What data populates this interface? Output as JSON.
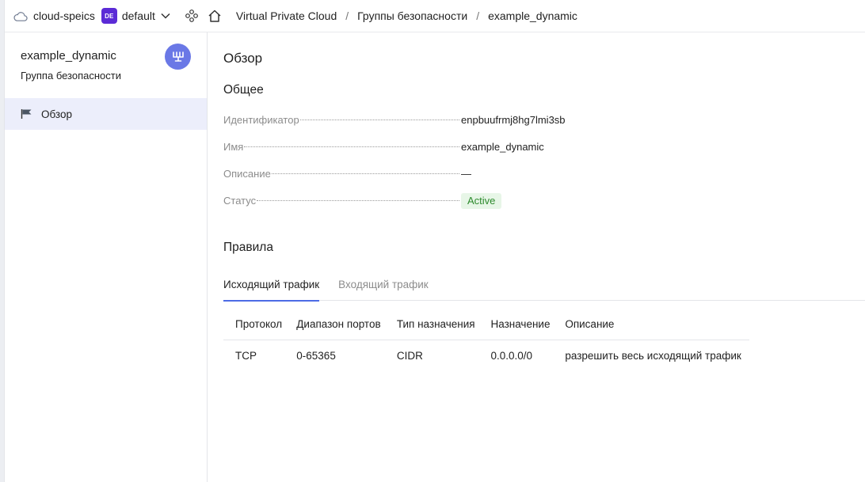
{
  "topbar": {
    "cloud_name": "cloud-speics",
    "folder_badge": "DE",
    "folder_name": "default",
    "breadcrumbs": [
      "Virtual Private Cloud",
      "Группы безопасности",
      "example_dynamic"
    ],
    "separator": "/"
  },
  "sidebar": {
    "resource_title": "example_dynamic",
    "resource_subtitle": "Группа безопасности",
    "items": [
      {
        "label": "Обзор",
        "icon": "flag-icon",
        "active": true
      }
    ]
  },
  "main": {
    "page_title": "Обзор",
    "general_title": "Общее",
    "properties": [
      {
        "key": "Идентификатор",
        "value": "enpbuufrmj8hg7lmi3sb"
      },
      {
        "key": "Имя",
        "value": "example_dynamic"
      },
      {
        "key": "Описание",
        "value": "—"
      },
      {
        "key": "Статус",
        "value": "Active"
      }
    ],
    "rules_title": "Правила",
    "tabs": [
      {
        "label": "Исходящий трафик",
        "active": true
      },
      {
        "label": "Входящий трафик",
        "active": false
      }
    ],
    "table": {
      "columns": [
        "Протокол",
        "Диапазон портов",
        "Тип назначения",
        "Назначение",
        "Описание"
      ],
      "rows": [
        [
          "TCP",
          "0-65365",
          "CIDR",
          "0.0.0.0/0",
          "разрешить весь исходящий трафик"
        ]
      ]
    }
  },
  "colors": {
    "accent": "#4d6be5",
    "folder_badge_bg": "#5b2bd6",
    "avatar_bg": "#6a78e6",
    "active_nav_bg": "#eceefb",
    "status_bg": "#e7f6e7",
    "status_text": "#2d8a2d"
  }
}
